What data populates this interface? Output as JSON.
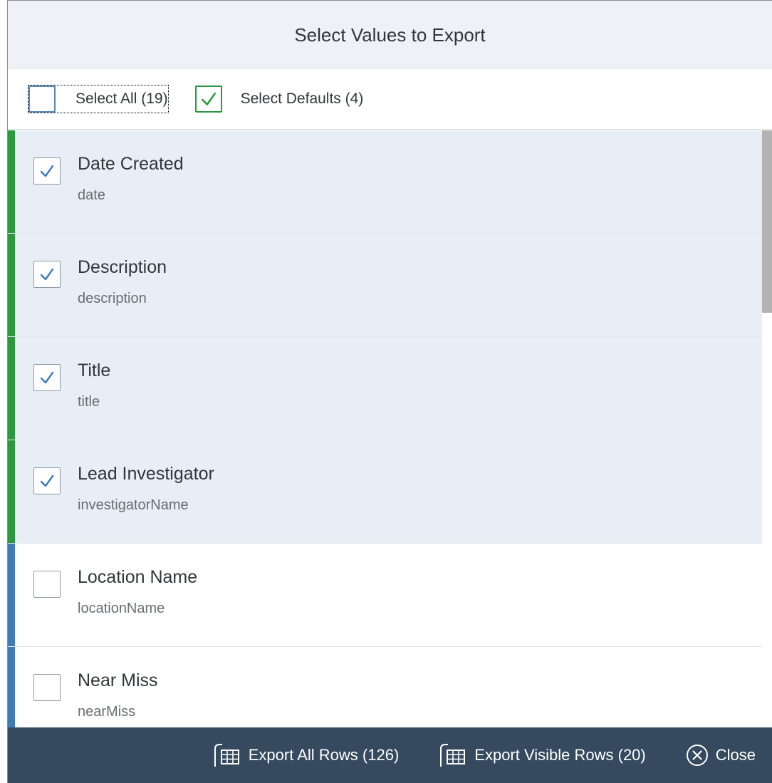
{
  "dialog": {
    "title": "Select Values to Export"
  },
  "select_bar": {
    "select_all_label": "Select All (19)",
    "select_defaults_label": "Select Defaults (4)"
  },
  "fields": [
    {
      "title": "Date Created",
      "key": "date",
      "checked": true
    },
    {
      "title": "Description",
      "key": "description",
      "checked": true
    },
    {
      "title": "Title",
      "key": "title",
      "checked": true
    },
    {
      "title": "Lead Investigator",
      "key": "investigatorName",
      "checked": true
    },
    {
      "title": "Location Name",
      "key": "locationName",
      "checked": false
    },
    {
      "title": "Near Miss",
      "key": "nearMiss",
      "checked": false
    }
  ],
  "footer": {
    "export_all_label": "Export All Rows (126)",
    "export_visible_label": "Export Visible Rows (20)",
    "close_label": "Close"
  },
  "icons": {
    "export": "spreadsheet-export-icon",
    "close": "circle-x-icon",
    "check": "checkmark-icon"
  },
  "colors": {
    "selected_accent": "#2b9a3f",
    "unselected_accent": "#3e7ab8",
    "selected_row_bg": "#e8eef6",
    "footer_bg": "#354a5f",
    "header_bg": "#eef2f7",
    "check_blue": "#3e7ab8"
  }
}
